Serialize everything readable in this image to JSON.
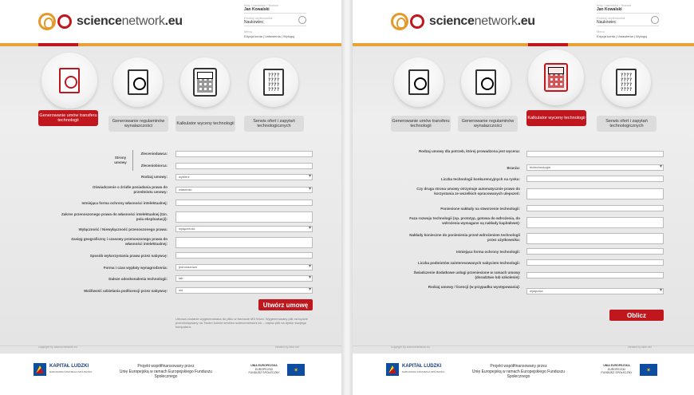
{
  "brand": {
    "name_bold": "science",
    "name_rest": "network",
    "tld": ".eu"
  },
  "user": {
    "label_name": "Imię i nazwisko / Nazwa",
    "name": "Jan Kowalski",
    "label_type": "Rodzaj użytkownika",
    "type": "Naukowiec",
    "label_menu": "Menu",
    "links": "Edycja konta | Ustawienia | Wyloguj"
  },
  "left": {
    "tabs": [
      {
        "label": "Generowanie umów transferu technologii",
        "active": true
      },
      {
        "label": "Generowanie regulaminów wynalazczości",
        "active": false
      },
      {
        "label": "Kalkulator wyceny technologii",
        "active": false
      },
      {
        "label": "Serwis ofert i zapytań technologicznych",
        "active": false
      }
    ],
    "form": {
      "strony_umowy": "Strony umowy",
      "zleceniodawca": "Zleceniodawca:",
      "zleceniobiorca": "Zleceniobiorca:",
      "rodzaj_umowy": "Rodzaj umowy:",
      "rodzaj_umowy_value": "wybierz",
      "oswiadczenie": "Oświadczenie o źródle posiadania prawa do przedmiotu umowy:",
      "oswiadczenie_value": "własność",
      "istniejaca_forma": "Istniejąca forma ochrony własności intelektualnej:",
      "zakres": "Zakres przenoszonego prawa do własności intelektualnej (tzn. pola eksploatacji):",
      "wylacznosc": "Wyłączność / Niewyłączność przenoszonego prawa:",
      "wylacznosc_value": "wyłączność",
      "zasieg": "Zasięg geograficzny i czasowy przenoszonego prawa do własności intelektualnej:",
      "sposob": "Sposób wykorzystania prawa przez nabywcę:",
      "forma_wyplaty": "Forma i czas wypłaty wynagrodzenia:",
      "forma_wyplaty_value": "jednorazowa",
      "dalsze": "Dalsze udoskonalenia technologii:",
      "dalsze_value": "tak",
      "mozliwosc": "Możliwość udzielania podlicencji przez nabywcę:",
      "mozliwosc_value": "nie",
      "submit": "Utwórz umowę",
      "note": "Umowa zostanie wygenerowana do pliku w formacie MS Word. Wygenerowany plik na będzie przechowywany na Twoim koncie serwisu sciencenetwork.eu – zapisz plik na dysku swojego komputera."
    },
    "footer_left": "copyright by sciencenetwork.eu",
    "footer_right": "created by take-net"
  },
  "right": {
    "tabs": [
      {
        "label": "Generowanie umów transferu technologii",
        "active": false
      },
      {
        "label": "Generowanie regulaminów wynalazczości",
        "active": false
      },
      {
        "label": "Kalkulator wyceny technologii",
        "active": true
      },
      {
        "label": "Serwis ofert i zapytań technologicznych",
        "active": false
      }
    ],
    "form": {
      "rodzaj_umowy": "Rodzaj umowy dla potrzeb, której prowadzona jest wycena:",
      "branza": "Branża:",
      "branza_value": "biotechnologia",
      "liczba_konkurencyjnych": "Liczba technologii konkurencyjnych na rynku:",
      "czy_druga_strona": "Czy druga strona umowy otrzymuje automatycznie prawo do korzystania ze wszelkich opracowanych ulepszeń:",
      "poniesione_naklady": "Poniesione nakłady na stworzenie technologii:",
      "faza_rozwoju": "Faza rozwoju technologii (np. prototyp, gotowa do wdrożenia, do wdrożenia wymagane są nakłady kapitałowe):",
      "naklady_konieczne": "Nakłady konieczne do poniesienia przed wdrożeniem technologii przez użytkownika:",
      "istniejaca_forma": "Istniejąca forma ochrony technologii:",
      "liczba_podmiotow": "Liczba podmiotów zainteresowanych nabyciem technologii:",
      "swiadczenie": "Świadczenie dodatkowe usługi przeniesione w ramach umowy (doradztwo lub szkolenie):",
      "rodzaj_licencji": "Rodzaj umowy / licencji (w przypadku występowania):",
      "rodzaj_licencji_value": "wyłączna",
      "submit": "Oblicz"
    },
    "footer_left": "copyright by sciencenetwork.eu",
    "footer_right": "created by take-net"
  },
  "eu": {
    "kl_title": "KAPITAŁ LUDZKI",
    "kl_sub": "NARODOWA STRATEGIA SPÓJNOŚCI",
    "project_line1": "Projekt współfinansowany przez",
    "project_line2": "Unię Europejską w ramach Europejskiego Funduszu Społecznego",
    "ue_line1": "UNIA EUROPEJSKA",
    "ue_line2": "EUROPEJSKI",
    "ue_line3": "FUNDUSZ SPOŁECZNY"
  },
  "colors": {
    "accent": "#c0161d",
    "stripe": "#e7a33a"
  }
}
